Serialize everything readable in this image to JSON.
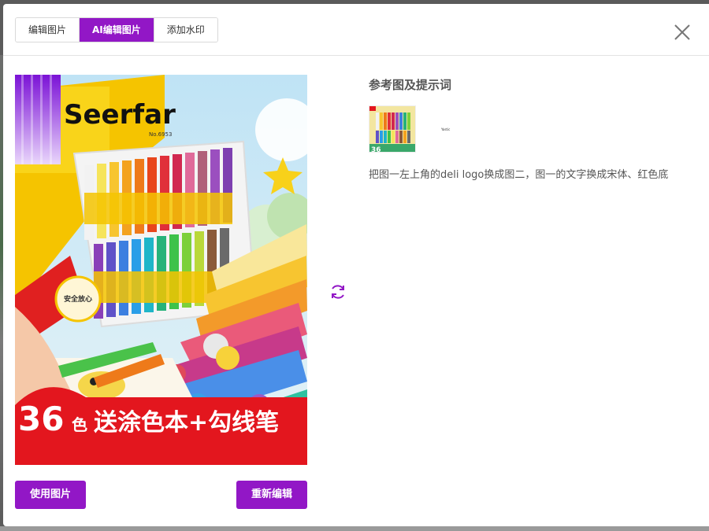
{
  "tabs": [
    {
      "label": "编辑图片",
      "active": false
    },
    {
      "label": "AI编辑图片",
      "active": true
    },
    {
      "label": "添加水印",
      "active": false
    }
  ],
  "accent_color": "#9217c6",
  "result_image": {
    "brand": "Seerfar",
    "model": "No.6953",
    "badge": "安全放心",
    "banner_count": "36",
    "banner_unit": "色",
    "banner_text": "送涂色本+勾线笔"
  },
  "actions": {
    "use_label": "使用图片",
    "reedit_label": "重新编辑"
  },
  "reference": {
    "title": "参考图及提示词",
    "thumb_banner": "36",
    "small_logo": "Yastic",
    "prompt": "把图一左上角的deli logo换成图二，图一的文字换成宋体、红色底"
  },
  "icons": {
    "close": "close-icon",
    "refresh": "refresh-icon"
  }
}
